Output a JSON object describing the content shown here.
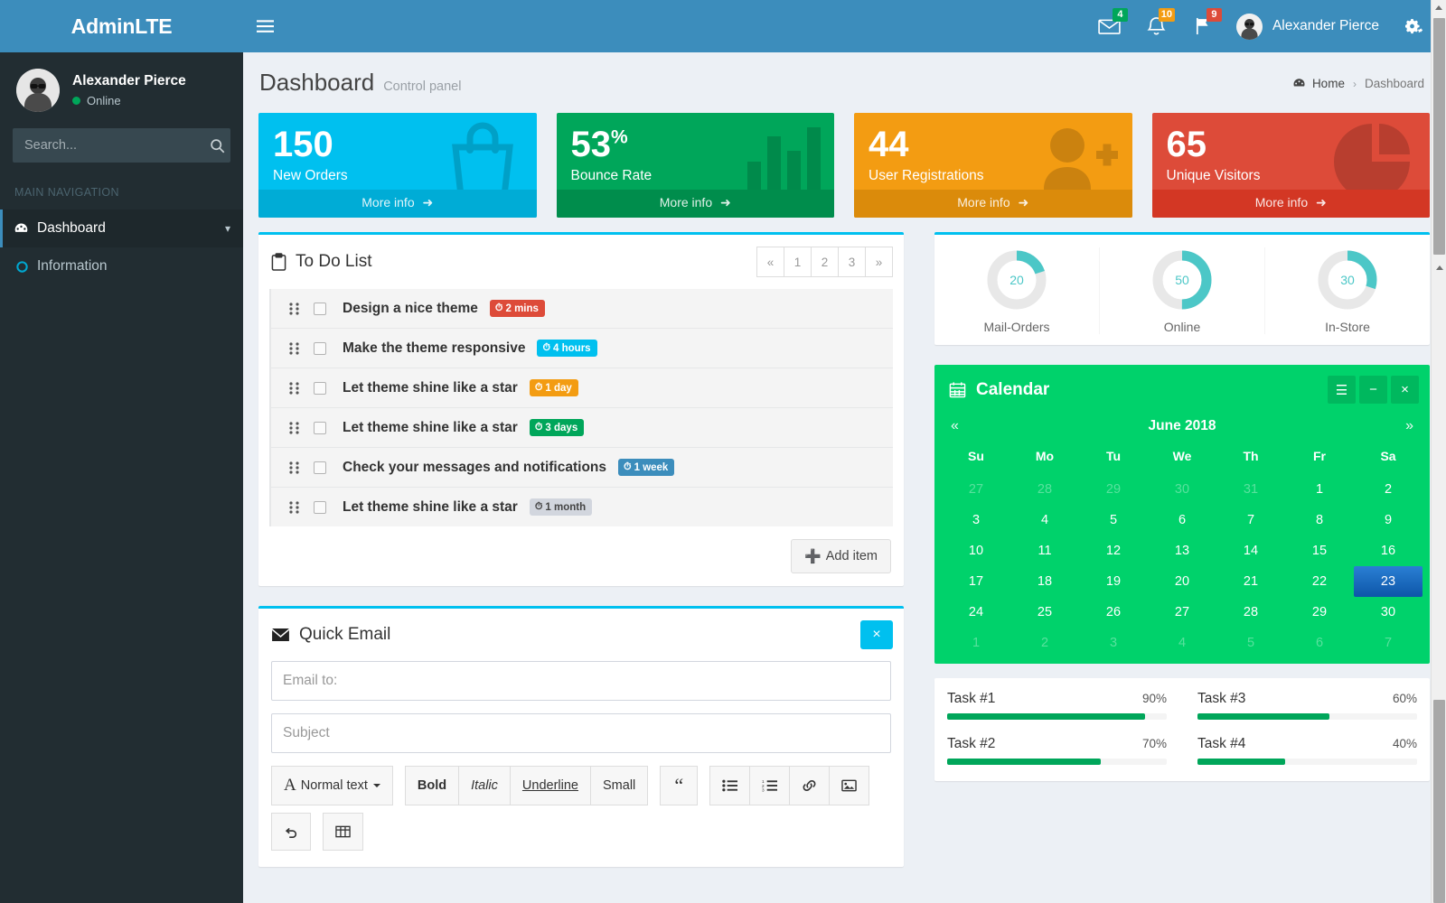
{
  "brand": {
    "title": "AdminLTE"
  },
  "sidebar": {
    "user": {
      "name": "Alexander Pierce",
      "status": "Online"
    },
    "search": {
      "placeholder": "Search...",
      "value": ""
    },
    "nav_header": "MAIN NAVIGATION",
    "items": [
      {
        "label": "Dashboard",
        "icon": "dashboard-icon",
        "active": true,
        "has_chevron": true
      },
      {
        "label": "Information",
        "icon": "circle-o-icon",
        "active": false,
        "has_chevron": false
      }
    ]
  },
  "navbar": {
    "messages": {
      "count": "4",
      "color": "#00a65a",
      "icon": "envelope-icon"
    },
    "notifications": {
      "count": "10",
      "color": "#f39c12",
      "icon": "bell-icon"
    },
    "tasks": {
      "count": "9",
      "color": "#dd4b39",
      "icon": "flag-icon"
    },
    "user_name": "Alexander Pierce",
    "settings_icon": "gears-icon"
  },
  "header": {
    "title": "Dashboard",
    "subtitle": "Control panel",
    "breadcrumb": {
      "home": "Home",
      "separator": "›",
      "current": "Dashboard"
    }
  },
  "small_boxes": [
    {
      "number": "150",
      "sup": "",
      "text": "New Orders",
      "footer": "More info",
      "bg": "#00c0ef",
      "footer_bg": "#00acd6",
      "icon": "shopping-bag-icon"
    },
    {
      "number": "53",
      "sup": "%",
      "text": "Bounce Rate",
      "footer": "More info",
      "bg": "#00a65a",
      "footer_bg": "#008d4c",
      "icon": "bar-chart-icon"
    },
    {
      "number": "44",
      "sup": "",
      "text": "User Registrations",
      "footer": "More info",
      "bg": "#f39c12",
      "footer_bg": "#db8b0b",
      "icon": "user-plus-icon"
    },
    {
      "number": "65",
      "sup": "",
      "text": "Unique Visitors",
      "footer": "More info",
      "bg": "#dd4b39",
      "footer_bg": "#d33724",
      "icon": "pie-chart-icon"
    }
  ],
  "todo": {
    "title": "To Do List",
    "icon": "clipboard-icon",
    "pagination": [
      "«",
      "1",
      "2",
      "3",
      "»"
    ],
    "items": [
      {
        "text": "Design a nice theme",
        "due": "2 mins",
        "color": "red"
      },
      {
        "text": "Make the theme responsive",
        "due": "4 hours",
        "color": "aqua"
      },
      {
        "text": "Let theme shine like a star",
        "due": "1 day",
        "color": "yellow"
      },
      {
        "text": "Let theme shine like a star",
        "due": "3 days",
        "color": "green"
      },
      {
        "text": "Check your messages and notifications",
        "due": "1 week",
        "color": "blue"
      },
      {
        "text": "Let theme shine like a star",
        "due": "1 month",
        "color": "grey"
      }
    ],
    "add_button": "Add item"
  },
  "quick_email": {
    "title": "Quick Email",
    "icon": "envelope-icon",
    "close_label": "×",
    "to_placeholder": "Email to:",
    "to_value": "",
    "subject_placeholder": "Subject",
    "subject_value": "",
    "toolbar": {
      "style_label": "Normal text",
      "bold": "Bold",
      "italic": "Italic",
      "underline": "Underline",
      "small": "Small",
      "quote": "“"
    }
  },
  "donuts": {
    "items": [
      {
        "value": "20",
        "label": "Mail-Orders",
        "percent": 20
      },
      {
        "value": "50",
        "label": "Online",
        "percent": 50
      },
      {
        "value": "30",
        "label": "In-Store",
        "percent": 30
      }
    ],
    "track_color": "#e8e8e8",
    "fill_color": "#4cc7c7"
  },
  "calendar": {
    "title": "Calendar",
    "icon": "calendar-icon",
    "tools": [
      "☰",
      "−",
      "×"
    ],
    "prev": "«",
    "next": "»",
    "month": "June 2018",
    "dow": [
      "Su",
      "Mo",
      "Tu",
      "We",
      "Th",
      "Fr",
      "Sa"
    ],
    "weeks": [
      [
        {
          "d": "27",
          "m": true
        },
        {
          "d": "28",
          "m": true
        },
        {
          "d": "29",
          "m": true
        },
        {
          "d": "30",
          "m": true
        },
        {
          "d": "31",
          "m": true
        },
        {
          "d": "1",
          "m": false
        },
        {
          "d": "2",
          "m": false
        }
      ],
      [
        {
          "d": "3",
          "m": false
        },
        {
          "d": "4",
          "m": false
        },
        {
          "d": "5",
          "m": false
        },
        {
          "d": "6",
          "m": false
        },
        {
          "d": "7",
          "m": false
        },
        {
          "d": "8",
          "m": false
        },
        {
          "d": "9",
          "m": false
        }
      ],
      [
        {
          "d": "10",
          "m": false
        },
        {
          "d": "11",
          "m": false
        },
        {
          "d": "12",
          "m": false
        },
        {
          "d": "13",
          "m": false
        },
        {
          "d": "14",
          "m": false
        },
        {
          "d": "15",
          "m": false
        },
        {
          "d": "16",
          "m": false
        }
      ],
      [
        {
          "d": "17",
          "m": false
        },
        {
          "d": "18",
          "m": false
        },
        {
          "d": "19",
          "m": false
        },
        {
          "d": "20",
          "m": false
        },
        {
          "d": "21",
          "m": false
        },
        {
          "d": "22",
          "m": false
        },
        {
          "d": "23",
          "m": false,
          "today": true
        }
      ],
      [
        {
          "d": "24",
          "m": false
        },
        {
          "d": "25",
          "m": false
        },
        {
          "d": "26",
          "m": false
        },
        {
          "d": "27",
          "m": false
        },
        {
          "d": "28",
          "m": false
        },
        {
          "d": "29",
          "m": false
        },
        {
          "d": "30",
          "m": false
        }
      ],
      [
        {
          "d": "1",
          "m": true
        },
        {
          "d": "2",
          "m": true
        },
        {
          "d": "3",
          "m": true
        },
        {
          "d": "4",
          "m": true
        },
        {
          "d": "5",
          "m": true
        },
        {
          "d": "6",
          "m": true
        },
        {
          "d": "7",
          "m": true
        }
      ]
    ],
    "today_bg": "#1461b5",
    "bg": "#00d26b"
  },
  "tasks": [
    {
      "name": "Task #1",
      "percent_label": "90%",
      "percent": 90
    },
    {
      "name": "Task #3",
      "percent_label": "60%",
      "percent": 60
    },
    {
      "name": "Task #2",
      "percent_label": "70%",
      "percent": 70
    },
    {
      "name": "Task #4",
      "percent_label": "40%",
      "percent": 40
    }
  ]
}
